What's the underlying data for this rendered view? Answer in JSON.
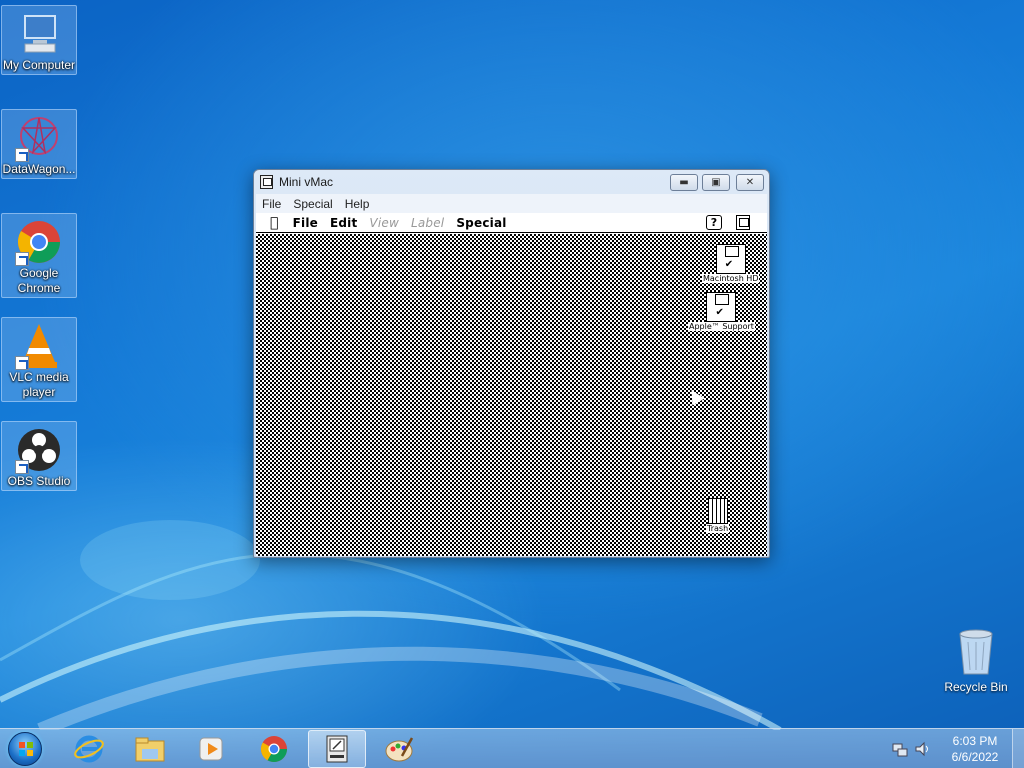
{
  "desktop": {
    "icons": [
      {
        "label": "My Computer",
        "icon": "computer-icon"
      },
      {
        "label": "DataWagon...",
        "icon": "datawagon-icon"
      },
      {
        "label": "Google Chrome",
        "icon": "chrome-icon"
      },
      {
        "label": "VLC media player",
        "icon": "vlc-icon"
      },
      {
        "label": "OBS Studio",
        "icon": "obs-icon"
      }
    ],
    "recycle_bin": "Recycle Bin"
  },
  "vmac": {
    "title": "Mini vMac",
    "host_menu": [
      "File",
      "Special",
      "Help"
    ],
    "mac_menu": [
      "File",
      "Edit",
      "View",
      "Label",
      "Special"
    ],
    "help_icon": "?",
    "disks": [
      "Macintosh HD",
      "Apple™ Support"
    ],
    "trash": "Trash"
  },
  "taskbar": {
    "apps": [
      "start-orb-icon",
      "internet-explorer-icon",
      "windows-explorer-icon",
      "media-player-icon",
      "chrome-icon",
      "mini-vmac-icon",
      "paint-icon"
    ],
    "time": "6:03 PM",
    "date": "6/6/2022"
  },
  "colors": {
    "wallpaper": "#1479d6",
    "taskbar": "#8fb4dc",
    "mac_screen": "#ffffff"
  }
}
